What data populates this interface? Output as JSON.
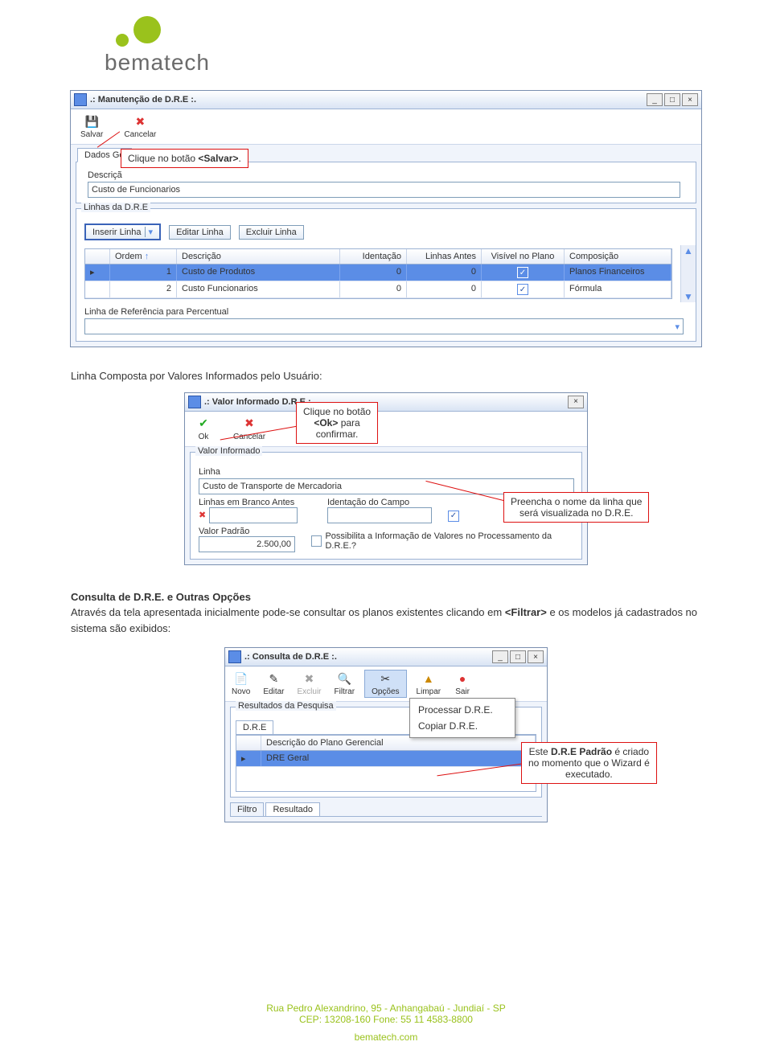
{
  "logo": {
    "name": "bematech"
  },
  "win1": {
    "title": ".: Manutenção de D.R.E :.",
    "tb": {
      "salvar": "Salvar",
      "cancelar": "Cancelar"
    },
    "dadosGerais": "Dados Ge",
    "descricaoLbl": "Descriçã",
    "descricaoVal": "Custo de Funcionarios",
    "linhasTitle": "Linhas da D.R.E",
    "btns": {
      "inserir": "Inserir Linha",
      "editar": "Editar Linha",
      "excluir": "Excluir Linha"
    },
    "cols": {
      "c0": "",
      "ordem": "Ordem",
      "arrow": "↑",
      "desc": "Descrição",
      "ident": "Identação",
      "antes": "Linhas Antes",
      "visivel": "Visível no Plano",
      "comp": "Composição"
    },
    "rows": [
      {
        "ordem": "1",
        "desc": "Custo de Produtos",
        "ident": "0",
        "antes": "0",
        "vis": true,
        "comp": "Planos Financeiros",
        "sel": true
      },
      {
        "ordem": "2",
        "desc": "Custo Funcionarios",
        "ident": "0",
        "antes": "0",
        "vis": true,
        "comp": "Fórmula",
        "sel": false
      }
    ],
    "refLbl": "Linha de Referência para Percentual"
  },
  "callouts": {
    "c1_a": "Clique no botão ",
    "c1_b": "<Salvar>",
    "c1_c": ".",
    "c2_a": "Clique no botão",
    "c2_b": "<Ok>",
    "c2_c": " para",
    "c2_d": "confirmar.",
    "c3_a": "Preencha o nome da linha que",
    "c3_b": "será visualizada no D.R.E.",
    "c4_a": "Este ",
    "c4_b": "D.R.E Padrão",
    "c4_c": " é criado",
    "c4_d": "no momento que o Wizard é",
    "c4_e": "executado."
  },
  "sect": {
    "body1": "Linha Composta por Valores Informados pelo Usuário:",
    "head2": "Consulta de D.R.E. e Outras Opções",
    "body2a": "Através da tela apresentada inicialmente pode-se consultar os planos existentes clicando em ",
    "body2b": "<Filtrar>",
    "body2c": " e os modelos já cadastrados no sistema são exibidos:"
  },
  "win2": {
    "title": ".: Valor Informado D.R.E :.",
    "tb": {
      "ok": "Ok",
      "cancelar": "Cancelar"
    },
    "panel": "Valor Informado",
    "linhaLbl": "Linha",
    "linhaVal": "Custo de Transporte de Mercadoria",
    "brancoLbl": "Linhas em Branco Antes",
    "identLbl": "Identação do Campo",
    "valorLbl": "Valor Padrão",
    "valorVal": "2.500,00",
    "possLbl": "Possibilita a Informação de Valores no Processamento da D.R.E.?"
  },
  "win3": {
    "title": ".: Consulta de D.R.E :.",
    "tb": {
      "novo": "Novo",
      "editar": "Editar",
      "excluir": "Excluir",
      "filtrar": "Filtrar",
      "opcoes": "Opções",
      "limpar": "Limpar",
      "sair": "Sair"
    },
    "resLbl": "Resultados da Pesquisa",
    "tabs": {
      "dre": "D.R.E"
    },
    "col": "Descrição do Plano Gerencial",
    "row": "DRE Geral",
    "menu": {
      "proc": "Processar D.R.E.",
      "cop": "Copiar D.R.E."
    },
    "filtTabs": {
      "filtro": "Filtro",
      "resultado": "Resultado"
    }
  },
  "footer": {
    "addr": "Rua Pedro Alexandrino, 95 - Anhangabaú - Jundiaí - SP",
    "cep": "CEP: 13208-160   Fone: 55 11 4583-8800",
    "site": "bematech.com"
  }
}
